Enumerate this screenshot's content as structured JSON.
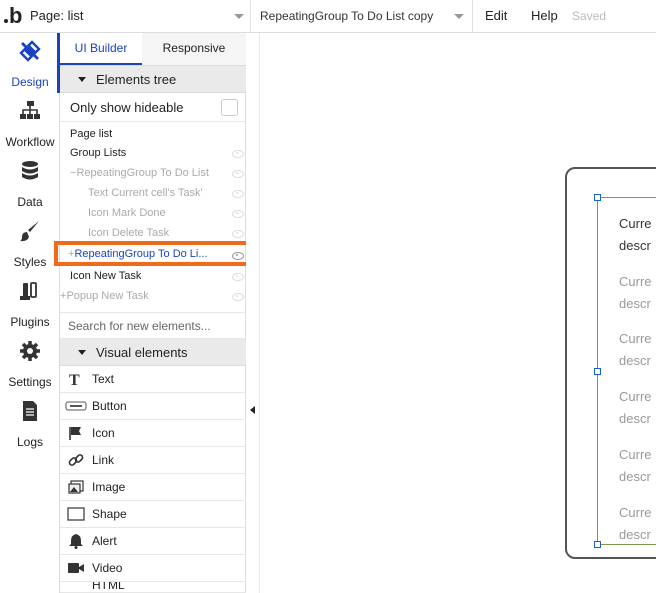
{
  "topbar": {
    "logo": "b",
    "page_label": "Page: list",
    "element_label": "RepeatingGroup To Do List copy",
    "menu_edit": "Edit",
    "menu_help": "Help",
    "status": "Saved"
  },
  "nav": [
    {
      "label": "Design",
      "icon": "design-icon"
    },
    {
      "label": "Workflow",
      "icon": "workflow-icon"
    },
    {
      "label": "Data",
      "icon": "database-icon"
    },
    {
      "label": "Styles",
      "icon": "brush-icon"
    },
    {
      "label": "Plugins",
      "icon": "plugin-icon"
    },
    {
      "label": "Settings",
      "icon": "gear-icon"
    },
    {
      "label": "Logs",
      "icon": "document-icon"
    }
  ],
  "panel": {
    "tabs": [
      "UI Builder",
      "Responsive"
    ],
    "elements_tree_title": "Elements tree",
    "only_show_hideable": "Only show hideable",
    "tree": [
      {
        "label": "Page list"
      },
      {
        "label": "Group Lists"
      },
      {
        "label": "RepeatingGroup To Do List"
      },
      {
        "label": "Text Current cell's Task'"
      },
      {
        "label": "Icon Mark Done"
      },
      {
        "label": "Icon Delete Task"
      },
      {
        "label": "RepeatingGroup To Do Li..."
      },
      {
        "label": "Icon New Task"
      },
      {
        "label": "Popup New Task"
      }
    ],
    "search_placeholder": "Search for new elements...",
    "visual_elements_title": "Visual elements",
    "visual_elements": [
      {
        "label": "Text",
        "icon": "text-icon"
      },
      {
        "label": "Button",
        "icon": "button-icon"
      },
      {
        "label": "Icon",
        "icon": "flag-icon"
      },
      {
        "label": "Link",
        "icon": "link-icon"
      },
      {
        "label": "Image",
        "icon": "image-icon"
      },
      {
        "label": "Shape",
        "icon": "shape-icon"
      },
      {
        "label": "Alert",
        "icon": "bell-icon"
      },
      {
        "label": "Video",
        "icon": "video-icon"
      },
      {
        "label": "HTML",
        "icon": "html-icon"
      }
    ]
  },
  "canvas": {
    "rows": [
      {
        "line1": "Curre",
        "line2": "descr"
      },
      {
        "line1": "Curre",
        "line2": "descr"
      },
      {
        "line1": "Curre",
        "line2": "descr"
      },
      {
        "line1": "Curre",
        "line2": "descr"
      },
      {
        "line1": "Curre",
        "line2": "descr"
      },
      {
        "line1": "Curre",
        "line2": "descr"
      }
    ]
  },
  "colors": {
    "accent": "#1a43c4",
    "highlight": "#f06a1c"
  }
}
